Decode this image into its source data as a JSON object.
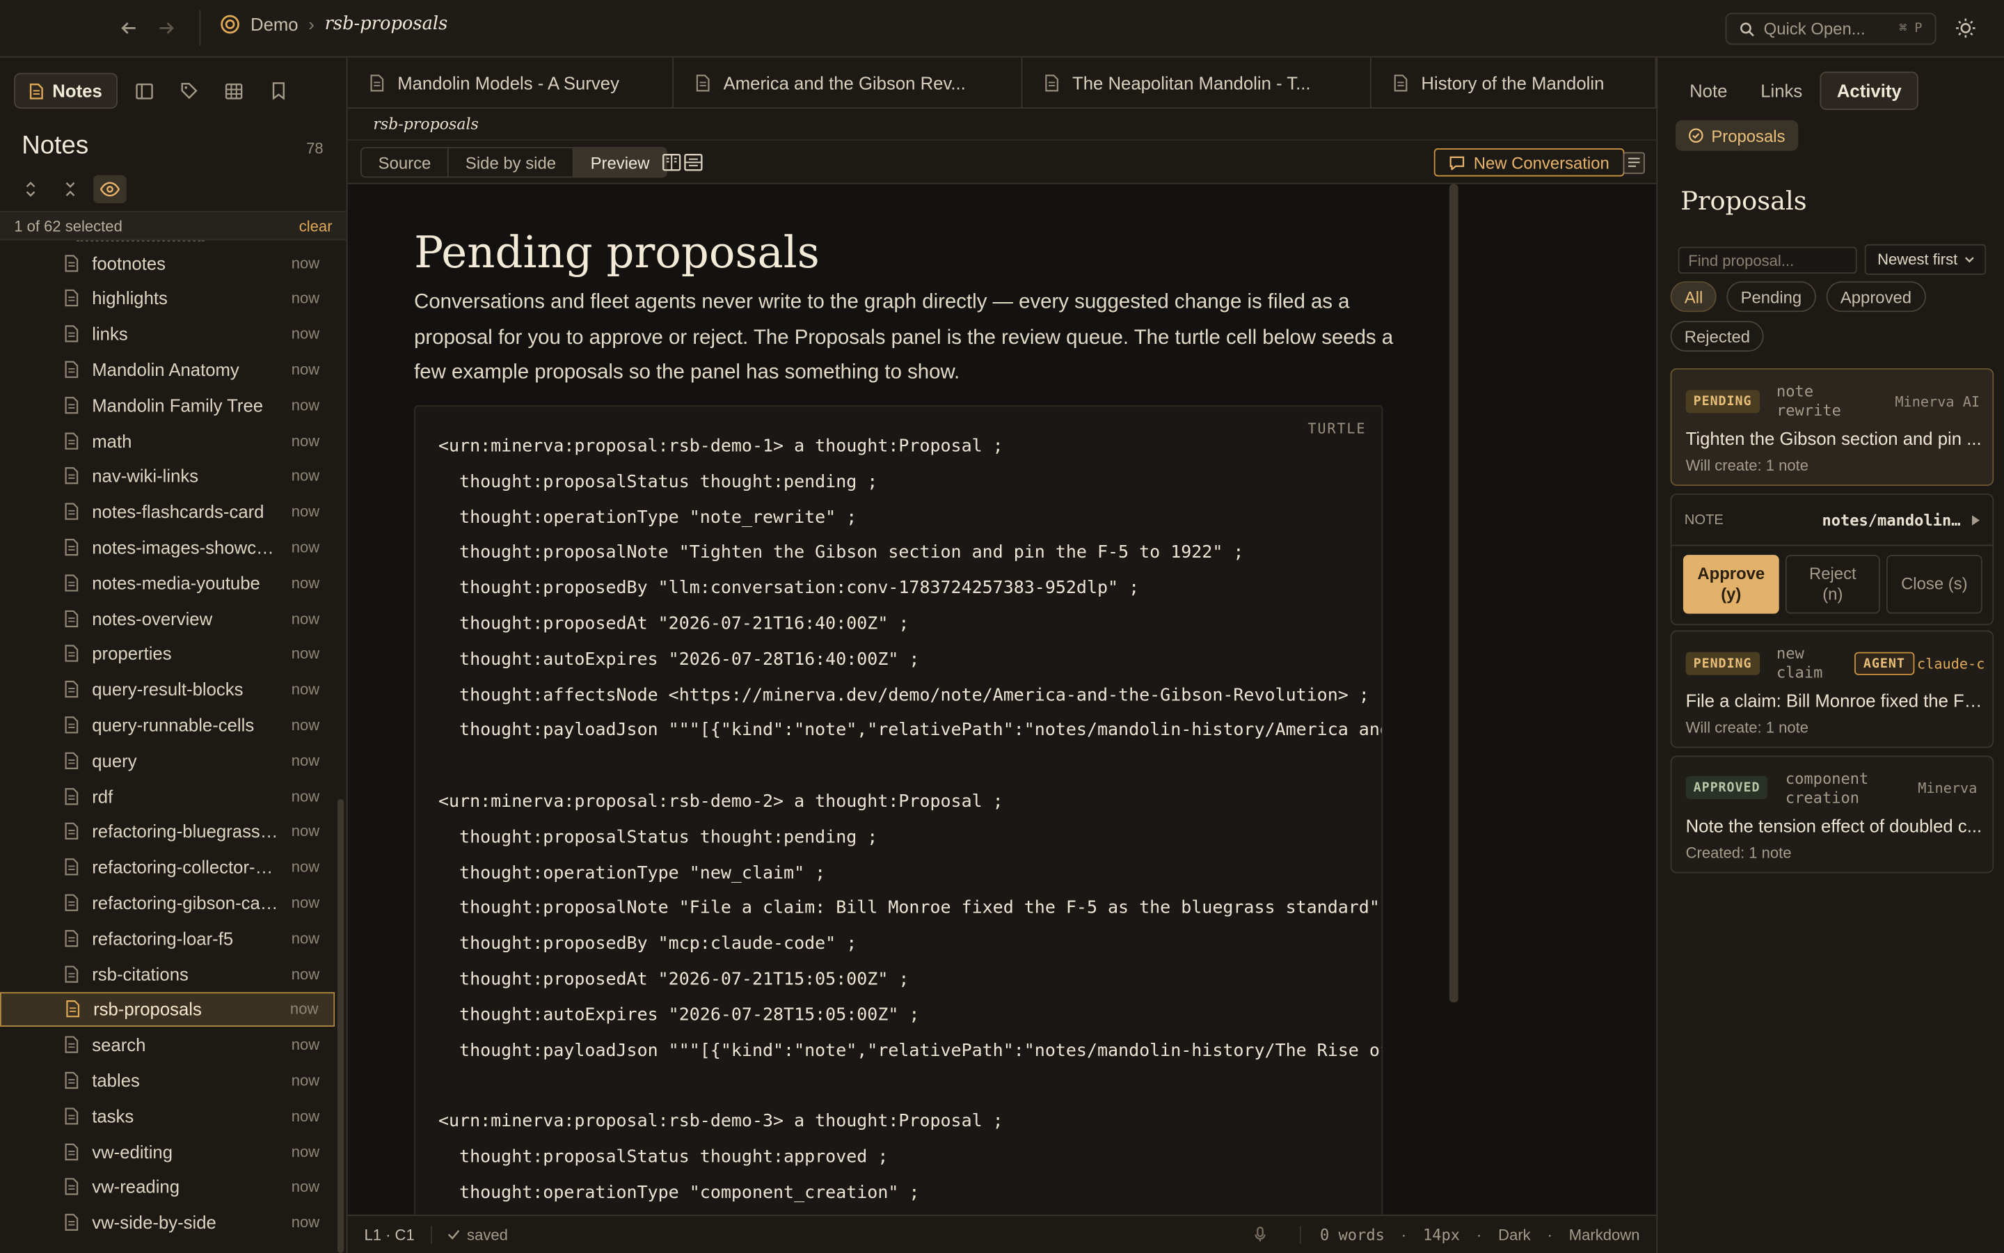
{
  "topbar": {
    "workspace": "Demo",
    "separator": "›",
    "current": "rsb-proposals",
    "quick_open": "Quick Open...",
    "quick_open_kbd": "⌘ P"
  },
  "sidebar": {
    "tab_notes": "Notes",
    "title": "Notes",
    "count": "78",
    "selection": "1 of 62 selected",
    "clear": "clear",
    "items": [
      {
        "name": "footnotes",
        "time": "now"
      },
      {
        "name": "highlights",
        "time": "now"
      },
      {
        "name": "links",
        "time": "now"
      },
      {
        "name": "Mandolin Anatomy",
        "time": "now"
      },
      {
        "name": "Mandolin Family Tree",
        "time": "now"
      },
      {
        "name": "math",
        "time": "now"
      },
      {
        "name": "nav-wiki-links",
        "time": "now"
      },
      {
        "name": "notes-flashcards-card",
        "time": "now"
      },
      {
        "name": "notes-images-showcase",
        "time": "now"
      },
      {
        "name": "notes-media-youtube",
        "time": "now"
      },
      {
        "name": "notes-overview",
        "time": "now"
      },
      {
        "name": "properties",
        "time": "now"
      },
      {
        "name": "query-result-blocks",
        "time": "now"
      },
      {
        "name": "query-runnable-cells",
        "time": "now"
      },
      {
        "name": "query",
        "time": "now"
      },
      {
        "name": "rdf",
        "time": "now"
      },
      {
        "name": "refactoring-bluegrass-standard",
        "time": "now"
      },
      {
        "name": "refactoring-collector-market",
        "time": "now"
      },
      {
        "name": "refactoring-gibson-carving",
        "time": "now"
      },
      {
        "name": "refactoring-loar-f5",
        "time": "now"
      },
      {
        "name": "rsb-citations",
        "time": "now"
      },
      {
        "name": "rsb-proposals",
        "time": "now"
      },
      {
        "name": "search",
        "time": "now"
      },
      {
        "name": "tables",
        "time": "now"
      },
      {
        "name": "tasks",
        "time": "now"
      },
      {
        "name": "vw-editing",
        "time": "now"
      },
      {
        "name": "vw-reading",
        "time": "now"
      },
      {
        "name": "vw-side-by-side",
        "time": "now"
      }
    ]
  },
  "tabs": [
    "Mandolin Models - A Survey",
    "America and the Gibson Rev...",
    "The Neapolitan Mandolin - T...",
    "History of the Mandolin"
  ],
  "editor": {
    "path": "rsb-proposals",
    "modes": [
      "Source",
      "Side by side",
      "Preview"
    ],
    "new_conversation": "New Conversation",
    "heading": "Pending proposals",
    "paragraph": "Conversations and fleet agents never write to the graph directly — every suggested change is filed as a proposal for you to approve or reject. The Proposals panel is the review queue. The turtle cell below seeds a few example proposals so the panel has something to show.",
    "code_lang": "TURTLE",
    "code": "<urn:minerva:proposal:rsb-demo-1> a thought:Proposal ;\n  thought:proposalStatus thought:pending ;\n  thought:operationType \"note_rewrite\" ;\n  thought:proposalNote \"Tighten the Gibson section and pin the F-5 to 1922\" ;\n  thought:proposedBy \"llm:conversation:conv-1783724257383-952dlp\" ;\n  thought:proposedAt \"2026-07-21T16:40:00Z\" ;\n  thought:autoExpires \"2026-07-28T16:40:00Z\" ;\n  thought:affectsNode <https://minerva.dev/demo/note/America-and-the-Gibson-Revolution> ;\n  thought:payloadJson \"\"\"[{\"kind\":\"note\",\"relativePath\":\"notes/mandolin-history/America and\n\n<urn:minerva:proposal:rsb-demo-2> a thought:Proposal ;\n  thought:proposalStatus thought:pending ;\n  thought:operationType \"new_claim\" ;\n  thought:proposalNote \"File a claim: Bill Monroe fixed the F-5 as the bluegrass standard\" ;\n  thought:proposedBy \"mcp:claude-code\" ;\n  thought:proposedAt \"2026-07-21T15:05:00Z\" ;\n  thought:autoExpires \"2026-07-28T15:05:00Z\" ;\n  thought:payloadJson \"\"\"[{\"kind\":\"note\",\"relativePath\":\"notes/mandolin-history/The Rise of\n\n<urn:minerva:proposal:rsb-demo-3> a thought:Proposal ;\n  thought:proposalStatus thought:approved ;\n  thought:operationType \"component_creation\" ;"
  },
  "status": {
    "position": "L1 · C1",
    "saved": "saved",
    "words": "0 words",
    "font_size": "14px",
    "theme": "Dark",
    "mode": "Markdown",
    "dot": "·"
  },
  "right": {
    "tabs": [
      "Note",
      "Links",
      "Activity"
    ],
    "chip": "Proposals",
    "title": "Proposals",
    "find_placeholder": "Find proposal...",
    "sort": "Newest first",
    "filters": [
      "All",
      "Pending",
      "Approved",
      "Rejected"
    ],
    "cards": [
      {
        "badge": "PENDING",
        "type": "note\nrewrite",
        "by": "Minerva AI",
        "title": "Tighten the Gibson section and pin ...",
        "meta": "Will create: 1 note"
      },
      {
        "badge": "PENDING",
        "type": "new\nclaim",
        "agent": "AGENT",
        "by": "claude-c",
        "title": "File a claim: Bill Monroe fixed the F-...",
        "meta": "Will create: 1 note"
      },
      {
        "badge": "APPROVED",
        "type": "component\ncreation",
        "by": "Minerva",
        "title": "Note the tension effect of doubled c...",
        "meta": "Created: 1 note"
      }
    ],
    "detail_label": "NOTE",
    "detail_value": "notes/mandolin…",
    "approve": "Approve\n(y)",
    "reject": "Reject\n(n)",
    "close": "Close (s)"
  },
  "colors": {
    "accent": "#e0a956",
    "bg": "#1d1a16",
    "editor_bg": "#141210"
  },
  "icons": [
    "back-arrow-icon",
    "forward-arrow-icon",
    "logo-icon",
    "search-icon",
    "theme-toggle-icon",
    "document-icon",
    "layout-icon",
    "tag-icon",
    "table-icon",
    "bookmark-icon",
    "expand-icon",
    "collapse-icon",
    "eye-icon",
    "chat-icon",
    "check-icon",
    "mic-icon",
    "caret-right-icon"
  ]
}
